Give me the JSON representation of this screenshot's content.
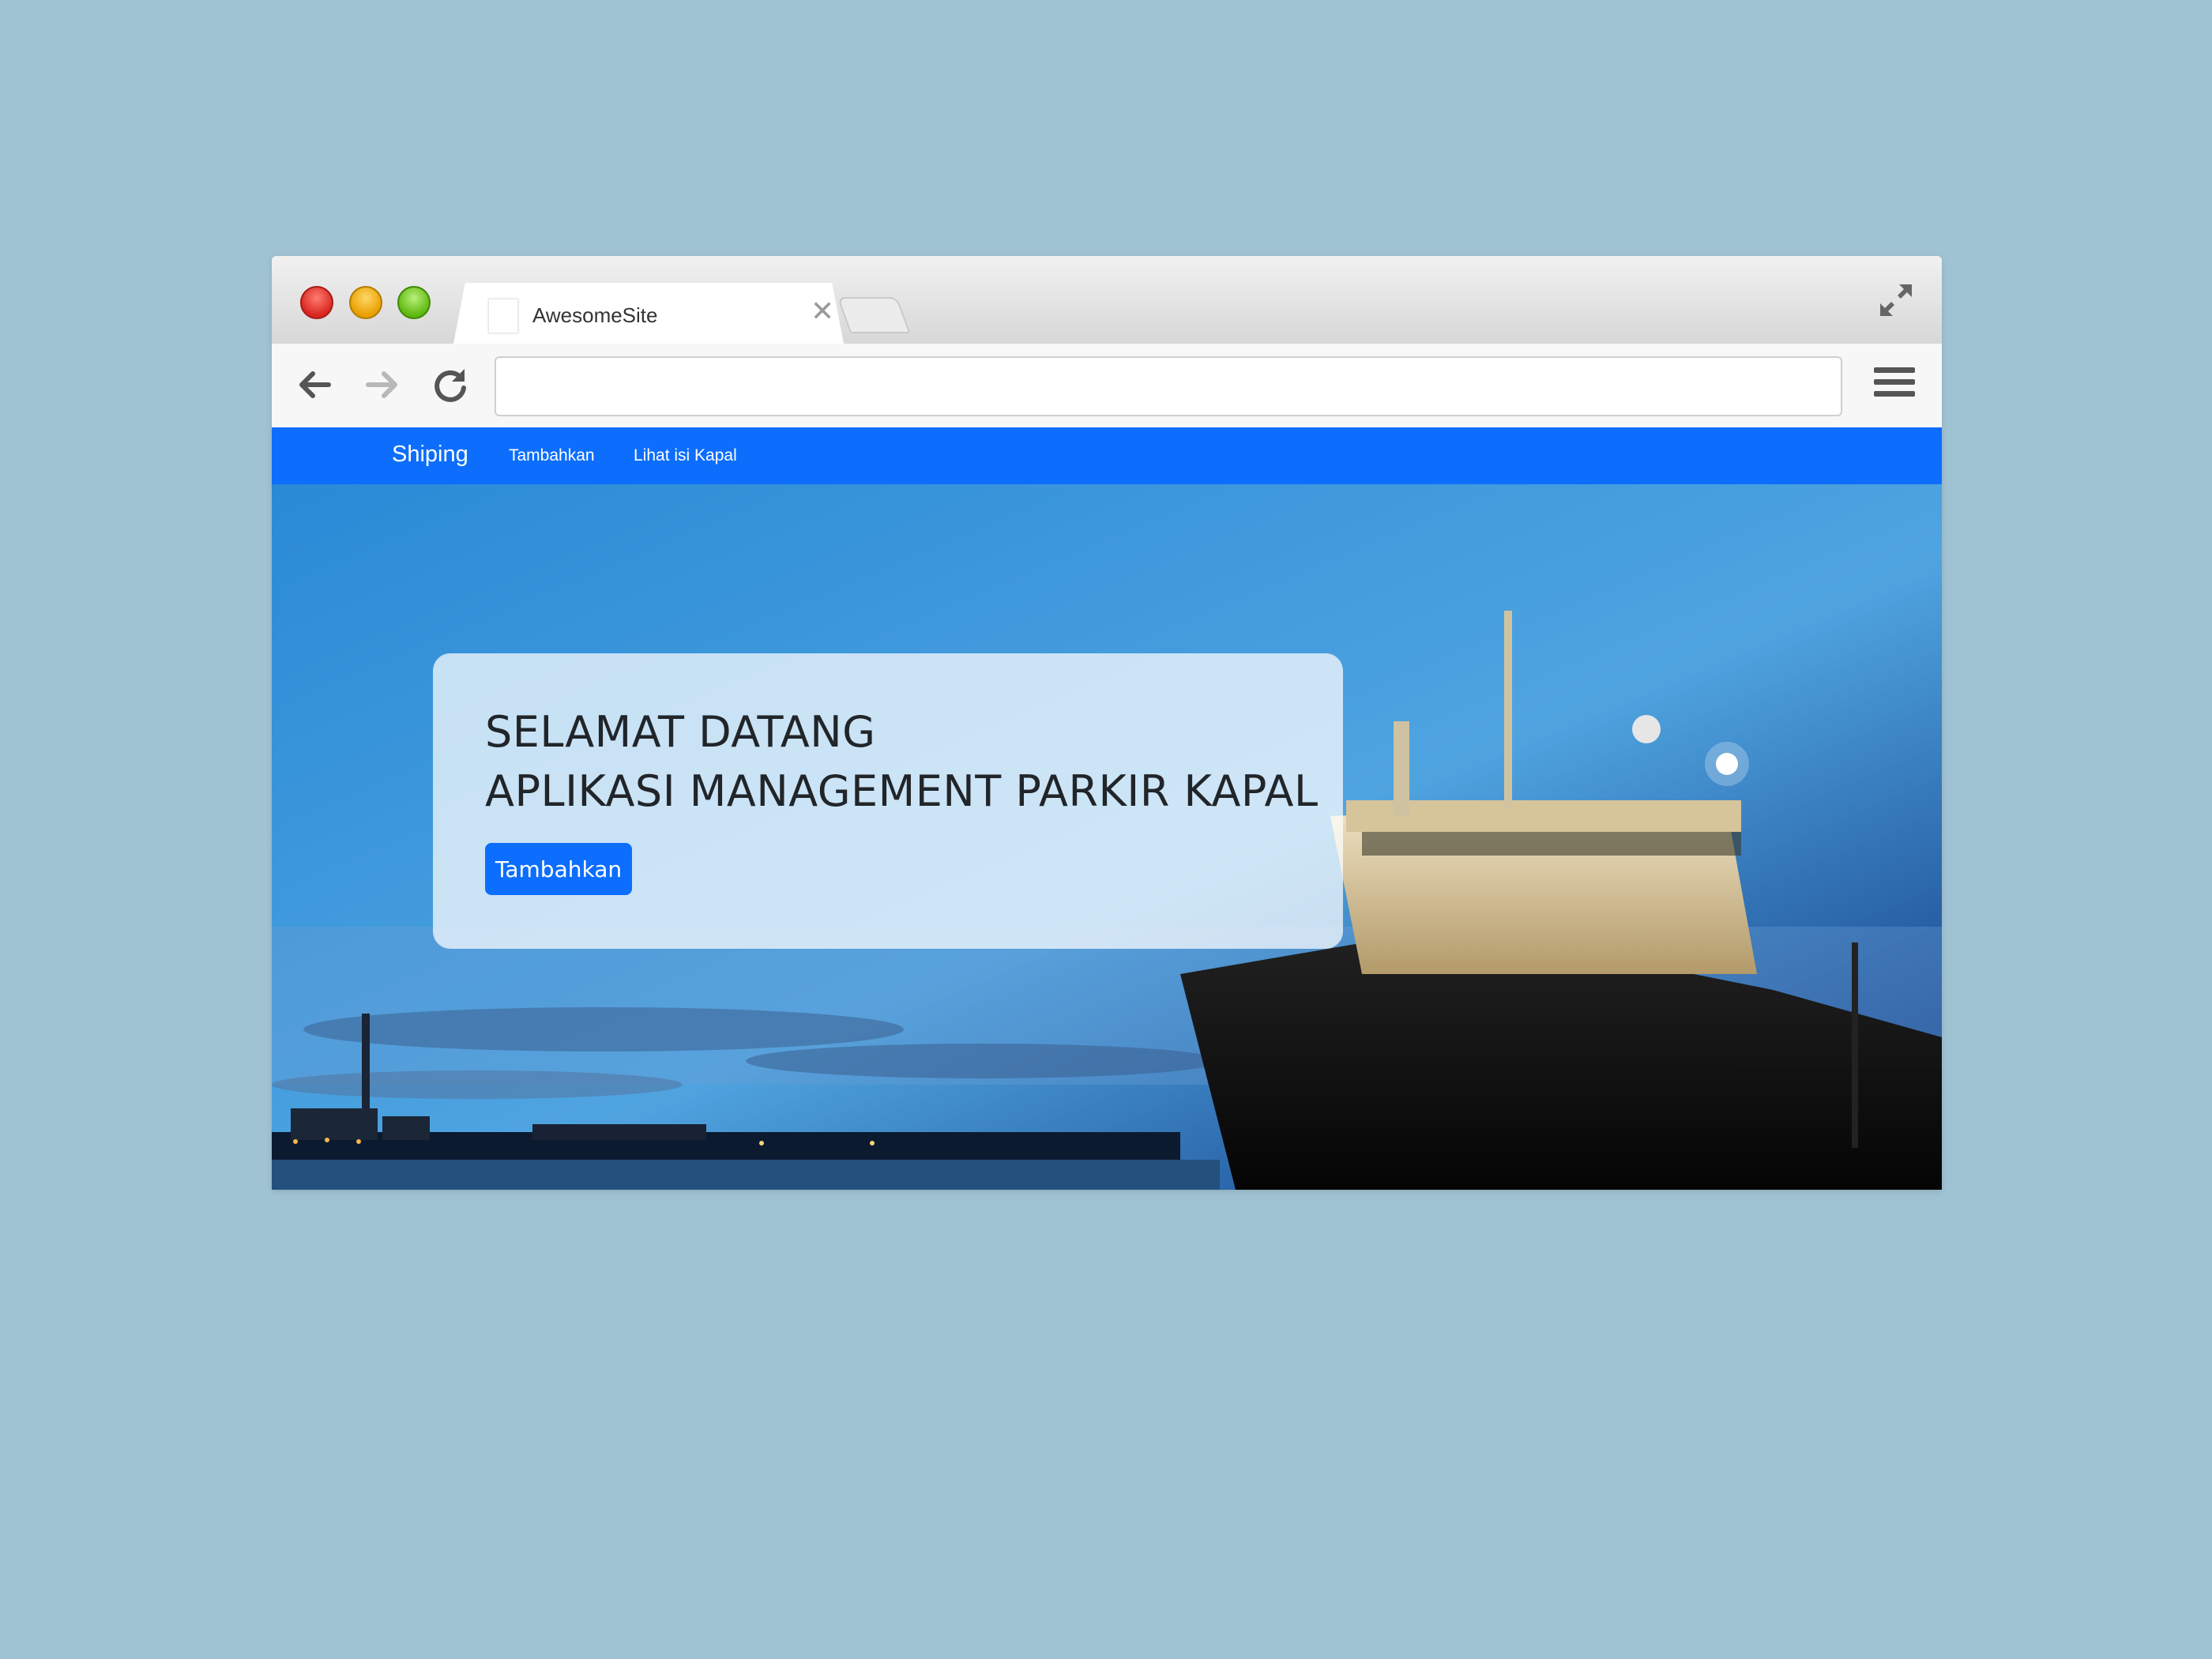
{
  "browser": {
    "tab_title": "AwesomeSite",
    "tab_close": "✕",
    "address_value": ""
  },
  "navbar": {
    "brand": "Shiping",
    "links": [
      "Tambahkan",
      "Lihat isi Kapal"
    ],
    "color": "#0d6efd"
  },
  "hero": {
    "heading_line1": "SELAMAT DATANG",
    "heading_line2": "APLIKASI MANAGEMENT PARKIR KAPAL",
    "button_label": "Tambahkan"
  },
  "icons": [
    "back-arrow-icon",
    "forward-arrow-icon",
    "reload-icon",
    "fullscreen-icon",
    "hamburger-menu-icon",
    "close-icon"
  ]
}
